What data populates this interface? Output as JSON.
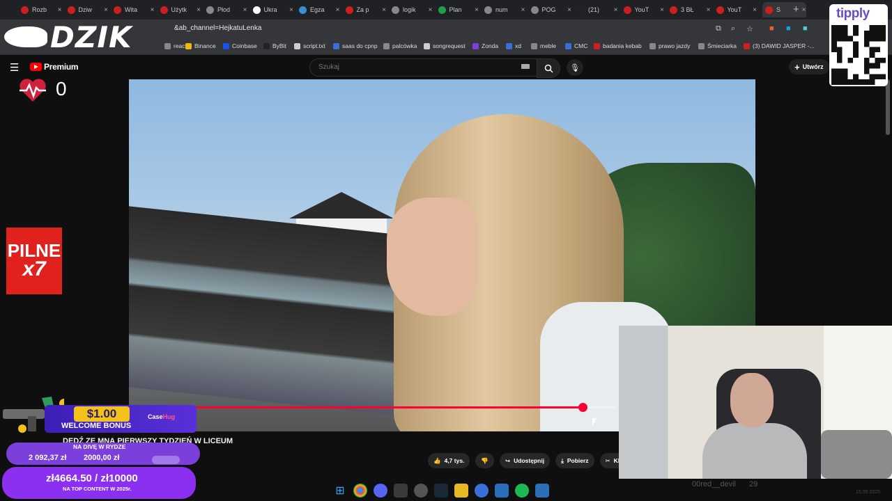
{
  "browser": {
    "tabs": [
      {
        "label": "Rozb",
        "color": "#cc1f1f"
      },
      {
        "label": "Dziw",
        "color": "#cc1f1f"
      },
      {
        "label": "Wita",
        "color": "#cc1f1f"
      },
      {
        "label": "Użytk",
        "color": "#cc1f1f"
      },
      {
        "label": "Płod",
        "color": "#888888"
      },
      {
        "label": "Ukra",
        "color": "#ffffff"
      },
      {
        "label": "Egza",
        "color": "#3a8ed8"
      },
      {
        "label": "Za p",
        "color": "#cc1f1f"
      },
      {
        "label": "logik",
        "color": "#888888"
      },
      {
        "label": "Plan",
        "color": "#1e9e4a"
      },
      {
        "label": "num",
        "color": "#888888"
      },
      {
        "label": "POG",
        "color": "#888888"
      },
      {
        "label": "(21)",
        "color": "#222222"
      },
      {
        "label": "YouT",
        "color": "#cc1f1f"
      },
      {
        "label": "3 BŁ",
        "color": "#cc1f1f"
      },
      {
        "label": "YouT",
        "color": "#cc1f1f"
      },
      {
        "label": "S",
        "color": "#cc1f1f"
      }
    ],
    "url": "&ab_channel=HejkatuLenka",
    "bookmarks": [
      {
        "label": "react",
        "color": "#888888"
      },
      {
        "label": "Binance",
        "color": "#f0b90b"
      },
      {
        "label": "Coinbase",
        "color": "#1652f0"
      },
      {
        "label": "ByBit",
        "color": "#222222"
      },
      {
        "label": "script.txt",
        "color": "#cccccc"
      },
      {
        "label": "saas do cpnp",
        "color": "#3a6fd8"
      },
      {
        "label": "palcówka",
        "color": "#888888"
      },
      {
        "label": "songrequest",
        "color": "#cccccc"
      },
      {
        "label": "Zonda",
        "color": "#7b3fdc"
      },
      {
        "label": "xd",
        "color": "#3a6fd8"
      },
      {
        "label": "meble",
        "color": "#888888"
      },
      {
        "label": "CMC",
        "color": "#3a6fd8"
      },
      {
        "label": "badania kebab",
        "color": "#cc1f1f"
      },
      {
        "label": "prawo jazdy",
        "color": "#888888"
      },
      {
        "label": "Śmieciarka",
        "color": "#888888"
      },
      {
        "label": "(3) DAWID JASPER -...",
        "color": "#cc1f1f"
      }
    ]
  },
  "youtube": {
    "logo_label": "Premium",
    "search_placeholder": "Szukaj",
    "create_label": "Utwórz",
    "video_title": "DEDŹ ZE MNĄ PIERWSZY TYDZIEŃ W LICEUM",
    "likes": "4,7 tys.",
    "share_label": "Udostępnij",
    "download_label": "Pobierz",
    "clip_label": "Kl",
    "progress_fraction": 0.93
  },
  "overlay": {
    "brand": "DZIK",
    "heart_count": "0",
    "pilne_line1": "PILNE",
    "pilne_line2": "x7",
    "tippy_label": "tipply",
    "bonus_amount": "$1.00",
    "bonus_label": "WELCOME BONUS",
    "casehug_a": "Case",
    "casehug_b": "Hug",
    "goal1_title": "NA DIVĘ W RYDZE",
    "goal1_current": "2 092,37 zł",
    "goal1_target": "2000,00 zł",
    "goal2_amount": "zł4664.50 / zł10000",
    "goal2_label": "NA TOP CONTENT W 2025r.",
    "chat_user": "00red__devil",
    "chat_count": "29",
    "date": "15.05.2025"
  },
  "colors": {
    "accent": "#ff0033",
    "bonus_gold": "#f2c21a",
    "goal_purple": "#7b3fdc",
    "pilne_red": "#e0211e"
  }
}
